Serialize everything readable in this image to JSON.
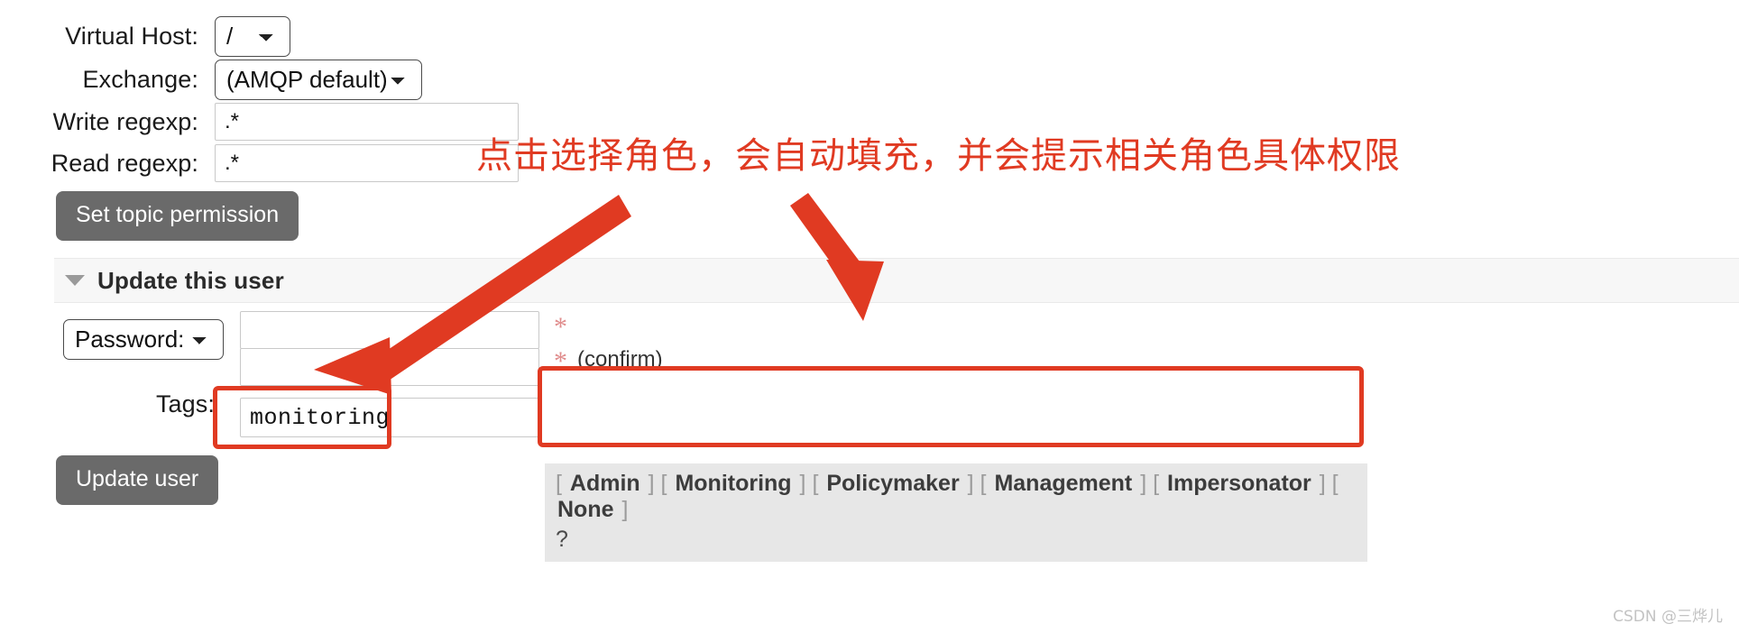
{
  "permissions_form": {
    "rows": [
      {
        "label": "Virtual Host:",
        "type": "select",
        "value": "/"
      },
      {
        "label": "Exchange:",
        "type": "select",
        "value": "(AMQP default)"
      },
      {
        "label": "Write regexp:",
        "type": "text",
        "value": ".*"
      },
      {
        "label": "Read regexp:",
        "type": "text",
        "value": ".*"
      }
    ],
    "submit_label": "Set topic permission"
  },
  "update_user_section": {
    "title": "Update this user",
    "collapse_icon": "triangle-down-icon",
    "password_select_label": "Password:",
    "password_value": "",
    "password_confirm_value": "",
    "required_marker": "*",
    "confirm_label": "(confirm)",
    "tags_label": "Tags:",
    "tags_value": "monitoring",
    "submit_label": "Update user"
  },
  "tag_suggestions": {
    "open_bracket": "[",
    "close_bracket": "]",
    "items": [
      "Admin",
      "Monitoring",
      "Policymaker",
      "Management",
      "Impersonator",
      "None"
    ],
    "help_label": "?"
  },
  "annotations": {
    "note_text": "点击选择角色，会自动填充，并会提示相关角色具体权限",
    "accent_color": "#e03a22",
    "arrow_to_tags": "arrow-icon",
    "arrow_to_popup": "arrow-icon",
    "highlight_tags_field": "highlight-box",
    "highlight_popup": "highlight-box"
  },
  "watermark": {
    "text": "CSDN @三烨儿"
  }
}
